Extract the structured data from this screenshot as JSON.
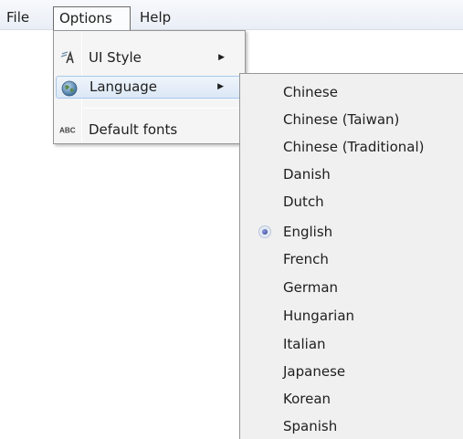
{
  "menubar": {
    "items": [
      "File",
      "Options",
      "Help"
    ]
  },
  "options_menu": {
    "items": [
      {
        "label": "UI Style",
        "icon": "ui-style-icon",
        "icon_glyph": "∂A",
        "has_submenu": true
      },
      {
        "label": "Language",
        "icon": "globe-icon",
        "icon_glyph": "●",
        "has_submenu": true,
        "highlighted": true
      },
      {
        "label": "Default fonts",
        "icon": "abc-fonts-icon",
        "icon_glyph": "ABC",
        "has_submenu": false
      }
    ],
    "submenu_arrow": "▶"
  },
  "language_menu": {
    "selected": "English",
    "items": [
      "Chinese",
      "Chinese (Taiwan)",
      "Chinese (Traditional)",
      "Danish",
      "Dutch",
      "English",
      "French",
      "German",
      "Hungarian",
      "Italian",
      "Japanese",
      "Korean",
      "Spanish"
    ]
  },
  "colors": {
    "highlight_border": "#a8c8ea",
    "radio_dot": "#2e3f9c"
  }
}
